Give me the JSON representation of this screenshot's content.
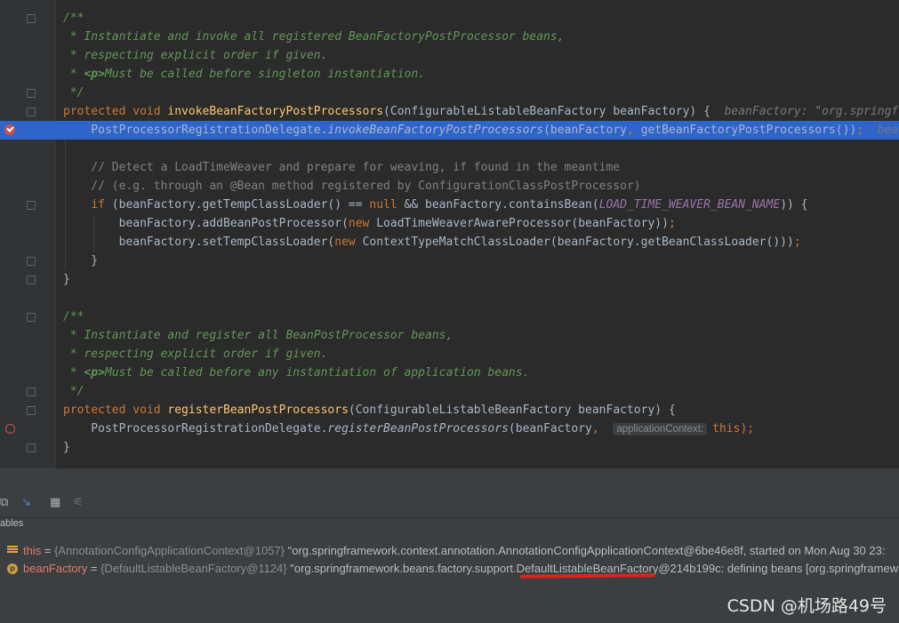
{
  "editor": {
    "lines": [
      {
        "segs": [
          {
            "t": "/**",
            "c": "cm"
          }
        ]
      },
      {
        "segs": [
          {
            "t": " * Instantiate and invoke all registered BeanFactoryPostProcessor beans,",
            "c": "cm"
          }
        ]
      },
      {
        "segs": [
          {
            "t": " * respecting explicit order if given.",
            "c": "cm"
          }
        ]
      },
      {
        "segs": [
          {
            "t": " * ",
            "c": "cm"
          },
          {
            "t": "<p>",
            "c": "tag"
          },
          {
            "t": "Must be called before singleton instantiation.",
            "c": "cm"
          }
        ]
      },
      {
        "segs": [
          {
            "t": " */",
            "c": "cm"
          }
        ]
      },
      {
        "segs": [
          {
            "t": "protected void ",
            "c": "kw"
          },
          {
            "t": "invokeBeanFactoryPostProcessors",
            "c": "fn"
          },
          {
            "t": "(ConfigurableListableBeanFactory beanFactory) {  "
          },
          {
            "t": "beanFactory: \"org.springframework.beans.factory.support.DefaultListableBeanFactory",
            "c": "hint"
          }
        ]
      },
      {
        "segs": [
          {
            "t": "    PostProcessorRegistrationDelegate."
          },
          {
            "t": "invokeBeanFactoryPostProcessors",
            "c": "it"
          },
          {
            "t": "(beanFactory"
          },
          {
            "t": ", ",
            "c": "kw"
          },
          {
            "t": "getBeanFactoryPostProcessors())"
          },
          {
            "t": ";",
            "c": "kw"
          },
          {
            "t": "  beanFactory: \"org.springframework",
            "c": "hint"
          }
        ]
      },
      {
        "segs": [
          {
            "t": ""
          }
        ]
      },
      {
        "segs": [
          {
            "t": "    // Detect a LoadTimeWeaver and prepare for weaving, if found in the meantime",
            "c": "lc"
          }
        ]
      },
      {
        "segs": [
          {
            "t": "    // (e.g. through an @Bean method registered by ConfigurationClassPostProcessor)",
            "c": "lc"
          }
        ]
      },
      {
        "segs": [
          {
            "t": "    "
          },
          {
            "t": "if ",
            "c": "kw"
          },
          {
            "t": "(beanFactory.getTempClassLoader() == "
          },
          {
            "t": "null ",
            "c": "kw"
          },
          {
            "t": "&& beanFactory.containsBean("
          },
          {
            "t": "LOAD_TIME_WEAVER_BEAN_NAME",
            "c": "st"
          },
          {
            "t": ")) {"
          }
        ]
      },
      {
        "segs": [
          {
            "t": "        beanFactory.addBeanPostProcessor("
          },
          {
            "t": "new ",
            "c": "kw"
          },
          {
            "t": "LoadTimeWeaverAwareProcessor(beanFactory))"
          },
          {
            "t": ";",
            "c": "kw"
          }
        ]
      },
      {
        "segs": [
          {
            "t": "        beanFactory.setTempClassLoader("
          },
          {
            "t": "new ",
            "c": "kw"
          },
          {
            "t": "ContextTypeMatchClassLoader(beanFactory.getBeanClassLoader()))"
          },
          {
            "t": ";",
            "c": "kw"
          }
        ]
      },
      {
        "segs": [
          {
            "t": "    }"
          }
        ]
      },
      {
        "segs": [
          {
            "t": "}"
          }
        ]
      },
      {
        "segs": [
          {
            "t": ""
          }
        ]
      },
      {
        "segs": [
          {
            "t": "/**",
            "c": "cm"
          }
        ]
      },
      {
        "segs": [
          {
            "t": " * Instantiate and register all BeanPostProcessor beans,",
            "c": "cm"
          }
        ]
      },
      {
        "segs": [
          {
            "t": " * respecting explicit order if given.",
            "c": "cm"
          }
        ]
      },
      {
        "segs": [
          {
            "t": " * ",
            "c": "cm"
          },
          {
            "t": "<p>",
            "c": "tag"
          },
          {
            "t": "Must be called before any instantiation of application beans.",
            "c": "cm"
          }
        ]
      },
      {
        "segs": [
          {
            "t": " */",
            "c": "cm"
          }
        ]
      },
      {
        "segs": [
          {
            "t": "protected void ",
            "c": "kw"
          },
          {
            "t": "registerBeanPostProcessors",
            "c": "fn"
          },
          {
            "t": "(ConfigurableListableBeanFactory beanFactory) {"
          }
        ]
      },
      {
        "segs": [
          {
            "t": "    PostProcessorRegistrationDelegate."
          },
          {
            "t": "registerBeanPostProcessors",
            "c": "it"
          },
          {
            "t": "(beanFactory"
          },
          {
            "t": ",  ",
            "c": "kw"
          },
          {
            "t": "applicationContext:",
            "c": "hintbox"
          },
          {
            "t": "this",
            "c": "kw"
          },
          {
            "t": ");",
            "c": "kw"
          }
        ]
      },
      {
        "segs": [
          {
            "t": "}"
          }
        ]
      }
    ]
  },
  "debugger": {
    "panel_title": "ables",
    "toolbar_icons": [
      "restore-layout-icon",
      "step-cursor-icon",
      "table-view-icon",
      "settings-icon"
    ],
    "variables": [
      {
        "icon": "fields-icon",
        "name": "this",
        "eq": " = ",
        "type": "{AnnotationConfigApplicationContext@1057} ",
        "value": "\"org.springframework.context.annotation.AnnotationConfigApplicationContext@6be46e8f, started on Mon Aug 30 23:"
      },
      {
        "icon": "parameter-icon",
        "name": "beanFactory",
        "eq": " = ",
        "type": "{DefaultListableBeanFactory@1124} ",
        "value": "\"org.springframework.beans.factory.support.DefaultListableBeanFactory@214b199c: defining beans [org.springframew"
      }
    ]
  },
  "watermark": "CSDN @机场路49号",
  "colors": {
    "selection": "#2f65ca",
    "breakpoint": "#c75450",
    "annotation_underline": "#e0221c"
  }
}
